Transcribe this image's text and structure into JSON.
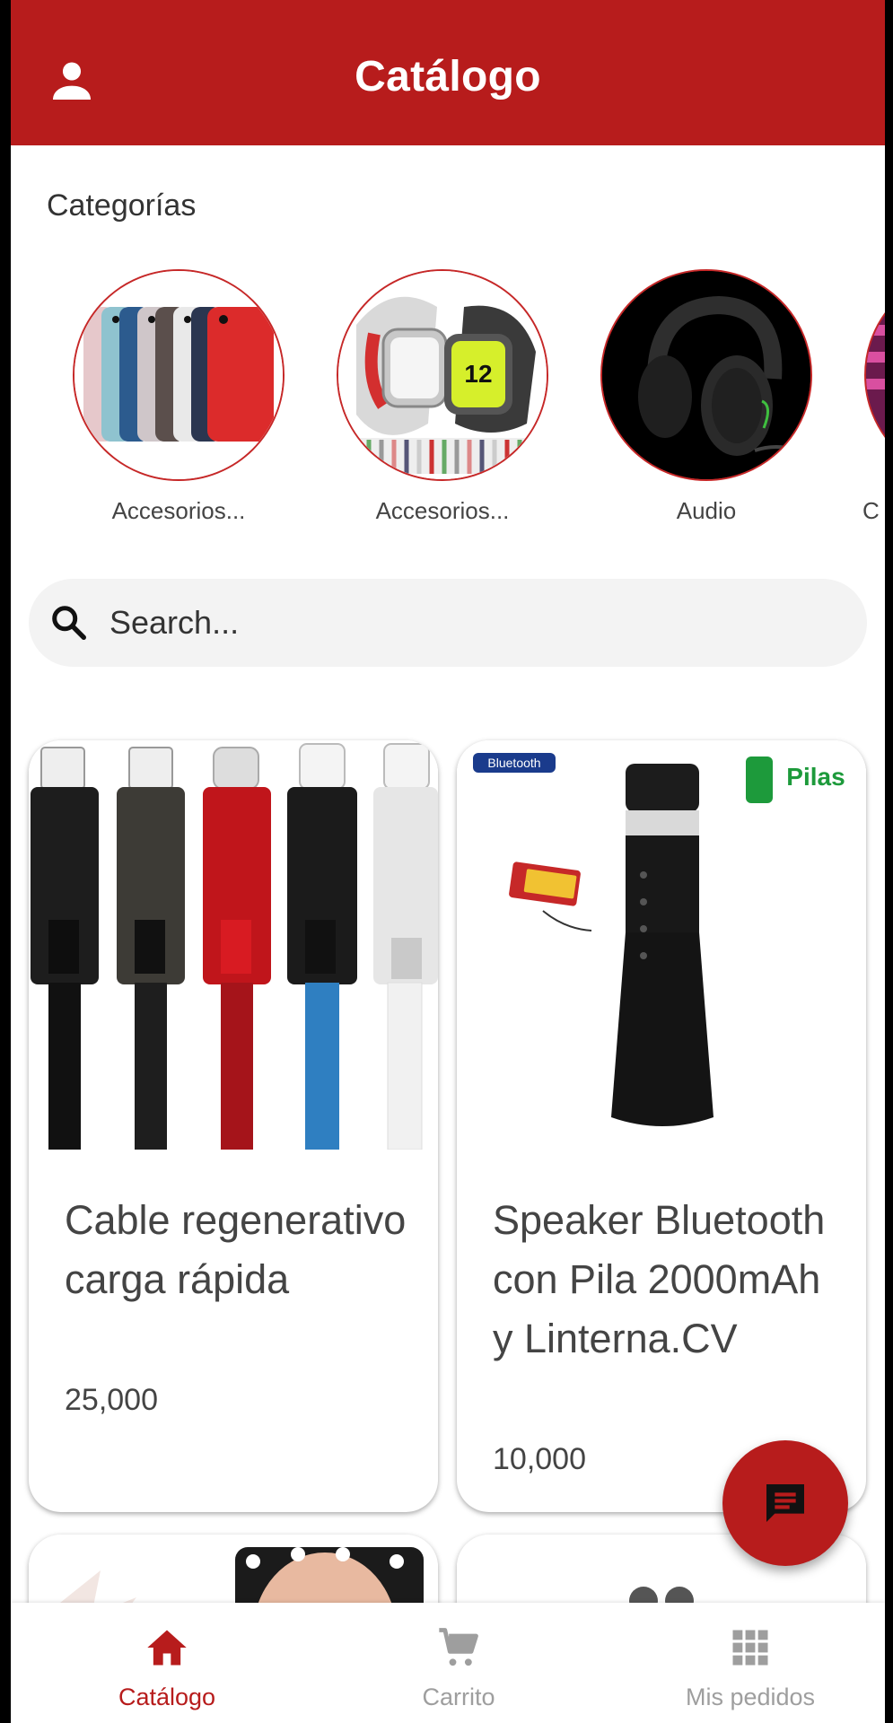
{
  "header": {
    "title": "Catálogo",
    "user_icon": "person-icon"
  },
  "categories": {
    "heading": "Categorías",
    "items": [
      {
        "label": "Accesorios..."
      },
      {
        "label": "Accesorios..."
      },
      {
        "label": "Audio"
      },
      {
        "label": "C"
      }
    ]
  },
  "search": {
    "placeholder": "Search..."
  },
  "products": [
    {
      "name": "Cable regenerativo carga rápida",
      "price": "25,000"
    },
    {
      "name": "Speaker Bluetooth con Pila 2000mAh y Linterna.CV",
      "price": "10,000"
    }
  ],
  "product_image_text": {
    "bluetooth": "Bluetooth",
    "pilas": "Pilas"
  },
  "fab": {
    "icon": "chat-icon"
  },
  "bottom_nav": {
    "items": [
      {
        "label": "Catálogo",
        "icon": "home-icon",
        "active": true
      },
      {
        "label": "Carrito",
        "icon": "cart-icon",
        "active": false
      },
      {
        "label": "Mis pedidos",
        "icon": "grid-icon",
        "active": false
      }
    ]
  },
  "colors": {
    "primary": "#b71c1c",
    "inactive": "#9e9e9e",
    "text": "#444444"
  }
}
